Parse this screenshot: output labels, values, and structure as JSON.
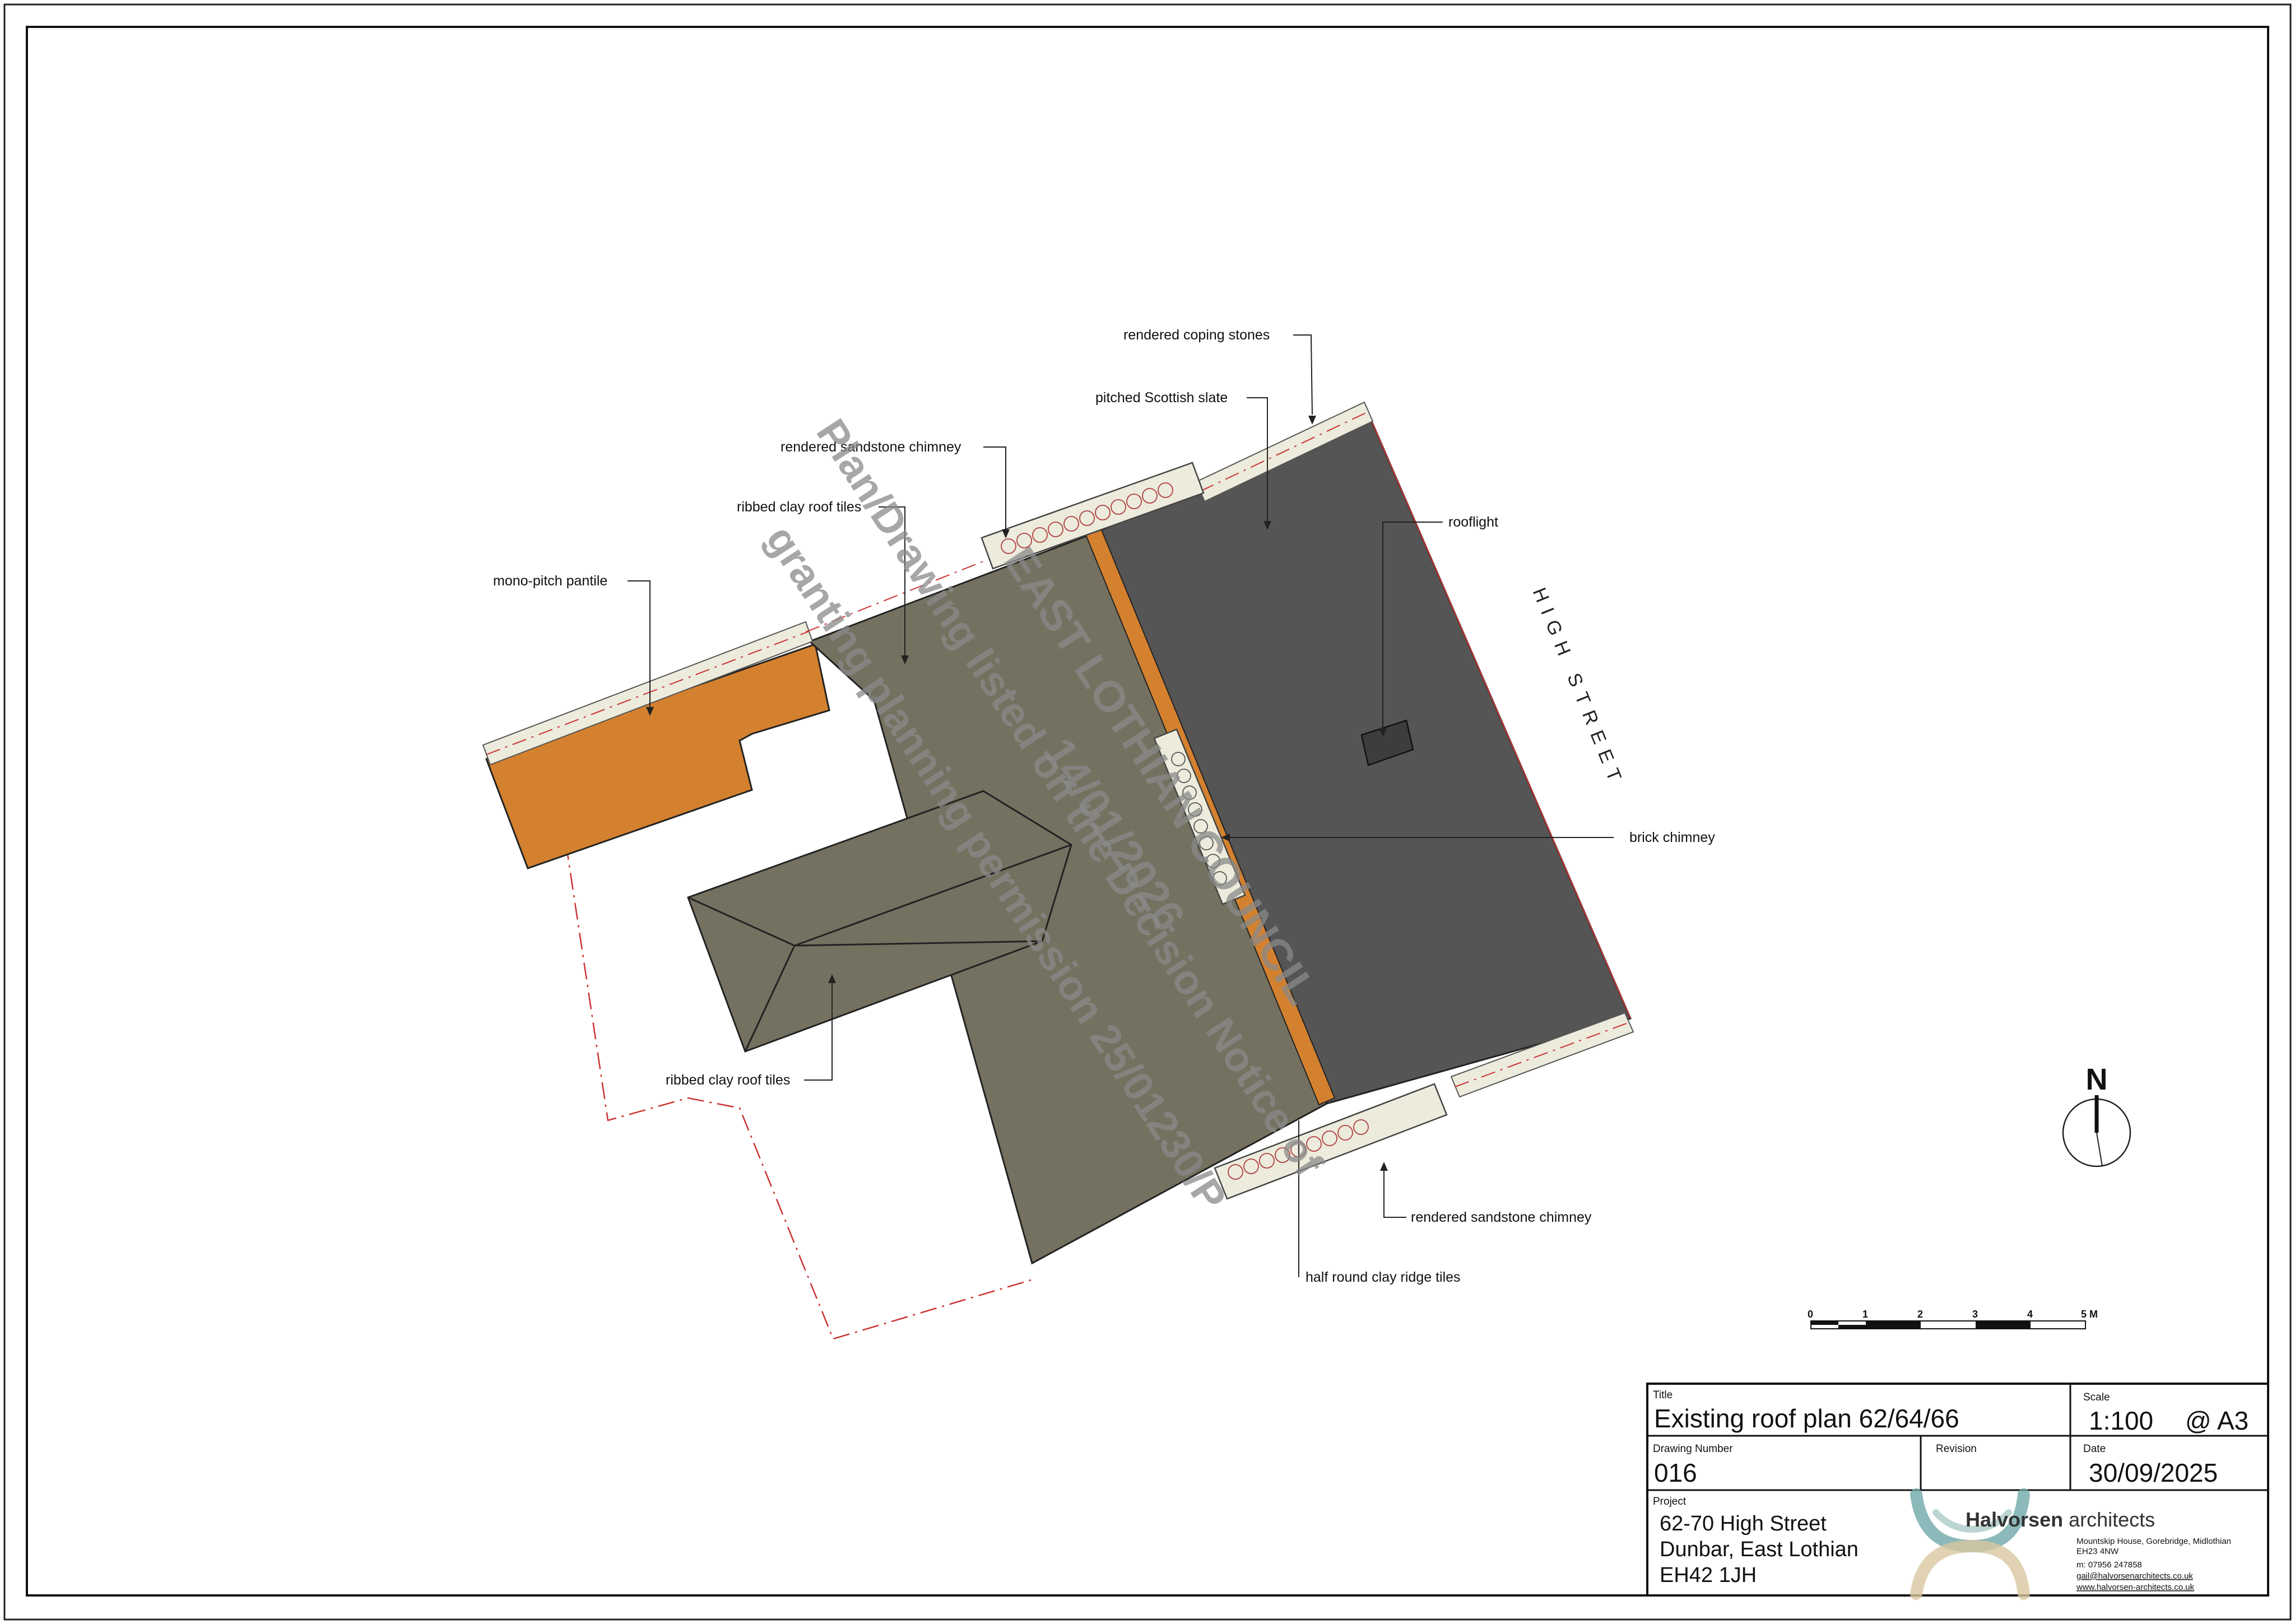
{
  "labels": {
    "rendered_coping_stones": "rendered coping stones",
    "pitched_scottish_slate": "pitched Scottish slate",
    "rendered_sandstone_chimney_top": "rendered sandstone chimney",
    "ribbed_clay_roof_tiles_top": "ribbed clay roof tiles",
    "mono_pitch_pantile": "mono-pitch pantile",
    "rooflight": "rooflight",
    "brick_chimney": "brick chimney",
    "ribbed_clay_roof_tiles_bottom": "ribbed clay roof tiles",
    "rendered_sandstone_chimney_bottom": "rendered sandstone chimney",
    "half_round_clay_ridge_tiles": "half round clay ridge tiles"
  },
  "street_name": "HIGH STREET",
  "watermark": {
    "line1": "EAST LOTHIAN COUNCIL",
    "line2": "Plan/Drawing listed on the Decision Notice of",
    "line3": "granting planning permission 25/01230/P",
    "line4": "14/01/2026"
  },
  "north": "N",
  "scale_bar": {
    "ticks": [
      "0",
      "1",
      "2",
      "3",
      "4",
      "5 M"
    ]
  },
  "title_block": {
    "title_caption": "Title",
    "title": "Existing roof plan 62/64/66",
    "scale_caption": "Scale",
    "scale": "1:100",
    "paper": "@ A3",
    "drawing_number_caption": "Drawing Number",
    "drawing_number": "016",
    "revision_caption": "Revision",
    "revision": "",
    "date_caption": "Date",
    "date": "30/09/2025",
    "project_caption": "Project",
    "project_line1": "62-70 High Street",
    "project_line2": "Dunbar, East Lothian",
    "project_line3": "EH42 1JH",
    "firm_name_bold": "Halvorsen",
    "firm_name_rest": " architects",
    "address_line1": "Mountskip House, Gorebridge, Midlothian",
    "address_line2": "EH23 4NW",
    "phone": "m: 07956 247858",
    "email": "gail@halvorsenarchitects.co.uk",
    "website": "www.halvorsen-architects.co.uk"
  },
  "colors": {
    "slate": "#555556",
    "clay_tiles": "#747160",
    "pantile": "#d4812f",
    "coping": "#ecebdc",
    "boundary": "#cc3333",
    "logo_teal": "#6fa7a8",
    "logo_sand": "#d8c7a0"
  }
}
